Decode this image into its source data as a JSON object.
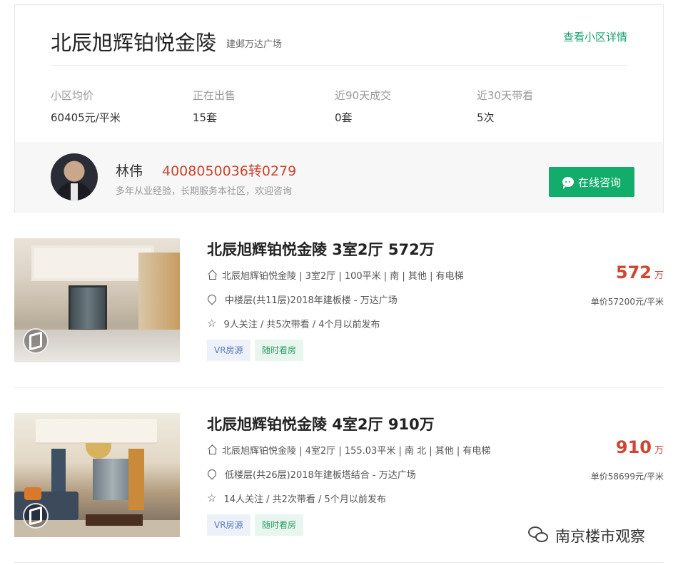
{
  "community": {
    "name": "北辰旭辉铂悦金陵",
    "area": "建邺万达广场",
    "detail_link": "查看小区详情",
    "stats": [
      {
        "label": "小区均价",
        "value": "60405元/平米"
      },
      {
        "label": "正在出售",
        "value": "15套"
      },
      {
        "label": "近90天成交",
        "value": "0套"
      },
      {
        "label": "近30天带看",
        "value": "5次"
      }
    ]
  },
  "agent": {
    "name": "林伟",
    "phone": "4008050036转0279",
    "description": "多年从业经验，长期服务本社区，欢迎咨询",
    "consult_label": "在线咨询"
  },
  "listings": [
    {
      "title": "北辰旭辉铂悦金陵 3室2厅 572万",
      "info": "北辰旭辉铂悦金陵 | 3室2厅 | 100平米 | 南 | 其他 | 有电梯",
      "position": "中楼层(共11层)2018年建板楼 - 万达广场",
      "follow": "9人关注 / 共5次带看 / 4个月以前发布",
      "tags": [
        "VR房源",
        "随时看房"
      ],
      "total_price": "572",
      "total_unit": "万",
      "unit_price": "单价57200元/平米"
    },
    {
      "title": "北辰旭辉铂悦金陵 4室2厅 910万",
      "info": "北辰旭辉铂悦金陵 | 4室2厅 | 155.03平米 | 南 北 | 其他 | 有电梯",
      "position": "低楼层(共26层)2018年建板塔结合 - 万达广场",
      "follow": "14人关注 / 共2次带看 / 5个月以前发布",
      "tags": [
        "VR房源",
        "随时看房"
      ],
      "total_price": "910",
      "total_unit": "万",
      "unit_price": "单价58699元/平米"
    }
  ],
  "watermark": "南京楼市观察",
  "icons": {
    "house": "house-icon",
    "location": "location-pin-icon",
    "star": "star-icon",
    "chat": "chat-bubble-icon",
    "vr": "vr-icon",
    "wechat": "wechat-icon"
  },
  "colors": {
    "accent_green": "#12ad6a",
    "price_red": "#d04530"
  }
}
